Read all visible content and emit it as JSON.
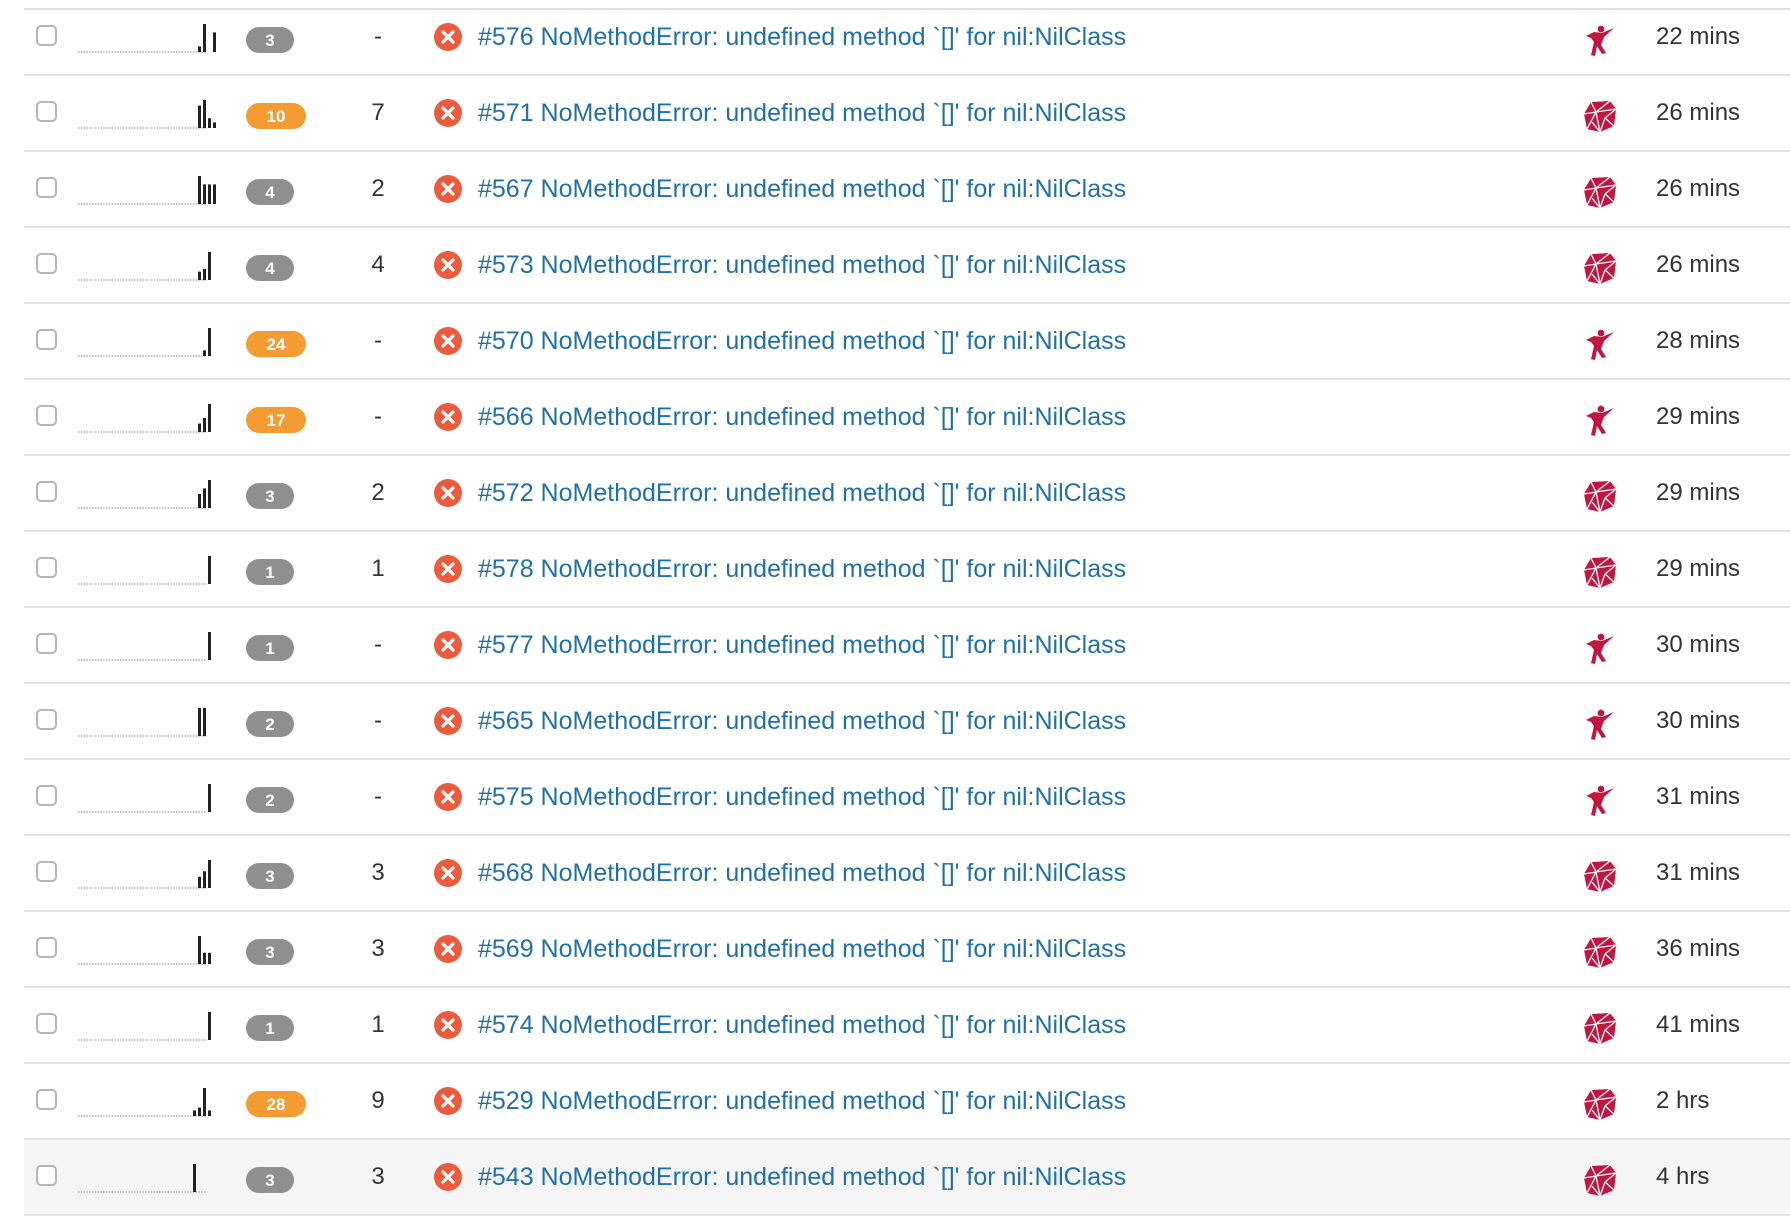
{
  "colors": {
    "link": "#1f6fb0",
    "badge_gray": "#8f8f8f",
    "badge_orange": "#f49b31",
    "error_icon": "#ee5a3c",
    "platform_icon": "#c4153f"
  },
  "rows": [
    {
      "id": "#576",
      "title": "#576 NoMethodError: undefined method `[]' for nil:NilClass",
      "badge": "3",
      "badge_color": "gray",
      "count": "-",
      "platform": "ninja-icon",
      "time": "22 mins",
      "spark": [
        0,
        0,
        0,
        0,
        0,
        0,
        0,
        0,
        0,
        0,
        0,
        0,
        0,
        0,
        0,
        0,
        0,
        0,
        0,
        0,
        0,
        0,
        0,
        0.2,
        1,
        0,
        0.7
      ]
    },
    {
      "id": "#571",
      "title": "#571 NoMethodError: undefined method `[]' for nil:NilClass",
      "badge": "10",
      "badge_color": "orange",
      "count": "7",
      "platform": "ruby-icon",
      "time": "26 mins",
      "spark": [
        0,
        0,
        0,
        0,
        0,
        0,
        0,
        0,
        0,
        0,
        0,
        0,
        0,
        0,
        0,
        0,
        0,
        0,
        0,
        0,
        0,
        0,
        0,
        0,
        0.8,
        1,
        0.35,
        0.2
      ]
    },
    {
      "id": "#567",
      "title": "#567 NoMethodError: undefined method `[]' for nil:NilClass",
      "badge": "4",
      "badge_color": "gray",
      "count": "2",
      "platform": "ruby-icon",
      "time": "26 mins",
      "spark": [
        0,
        0,
        0,
        0,
        0,
        0,
        0,
        0,
        0,
        0,
        0,
        0,
        0,
        0,
        0,
        0,
        0,
        0,
        0,
        0,
        0,
        0,
        0,
        1,
        0.7,
        0.7,
        0.7
      ]
    },
    {
      "id": "#573",
      "title": "#573 NoMethodError: undefined method `[]' for nil:NilClass",
      "badge": "4",
      "badge_color": "gray",
      "count": "4",
      "platform": "ruby-icon",
      "time": "26 mins",
      "spark": [
        0,
        0,
        0,
        0,
        0,
        0,
        0,
        0,
        0,
        0,
        0,
        0,
        0,
        0,
        0,
        0,
        0,
        0,
        0,
        0,
        0,
        0,
        0,
        0,
        0.3,
        0.4,
        1,
        0
      ]
    },
    {
      "id": "#570",
      "title": "#570 NoMethodError: undefined method `[]' for nil:NilClass",
      "badge": "24",
      "badge_color": "orange",
      "count": "-",
      "platform": "ninja-icon",
      "time": "28 mins",
      "spark": [
        0,
        0,
        0,
        0,
        0,
        0,
        0,
        0,
        0,
        0,
        0,
        0,
        0,
        0,
        0,
        0,
        0,
        0,
        0,
        0,
        0,
        0,
        0,
        0,
        0,
        0.2,
        1,
        0
      ]
    },
    {
      "id": "#566",
      "title": "#566 NoMethodError: undefined method `[]' for nil:NilClass",
      "badge": "17",
      "badge_color": "orange",
      "count": "-",
      "platform": "ninja-icon",
      "time": "29 mins",
      "spark": [
        0,
        0,
        0,
        0,
        0,
        0,
        0,
        0,
        0,
        0,
        0,
        0,
        0,
        0,
        0,
        0,
        0,
        0,
        0,
        0,
        0,
        0,
        0,
        0,
        0.3,
        0.5,
        1,
        0
      ]
    },
    {
      "id": "#572",
      "title": "#572 NoMethodError: undefined method `[]' for nil:NilClass",
      "badge": "3",
      "badge_color": "gray",
      "count": "2",
      "platform": "ruby-icon",
      "time": "29 mins",
      "spark": [
        0,
        0,
        0,
        0,
        0,
        0,
        0,
        0,
        0,
        0,
        0,
        0,
        0,
        0,
        0,
        0,
        0,
        0,
        0,
        0,
        0,
        0,
        0,
        0,
        0.5,
        0.7,
        1,
        0
      ]
    },
    {
      "id": "#578",
      "title": "#578 NoMethodError: undefined method `[]' for nil:NilClass",
      "badge": "1",
      "badge_color": "gray",
      "count": "1",
      "platform": "ruby-icon",
      "time": "29 mins",
      "spark": [
        0,
        0,
        0,
        0,
        0,
        0,
        0,
        0,
        0,
        0,
        0,
        0,
        0,
        0,
        0,
        0,
        0,
        0,
        0,
        0,
        0,
        0,
        0,
        0,
        0,
        0,
        1,
        0
      ]
    },
    {
      "id": "#577",
      "title": "#577 NoMethodError: undefined method `[]' for nil:NilClass",
      "badge": "1",
      "badge_color": "gray",
      "count": "-",
      "platform": "ninja-icon",
      "time": "30 mins",
      "spark": [
        0,
        0,
        0,
        0,
        0,
        0,
        0,
        0,
        0,
        0,
        0,
        0,
        0,
        0,
        0,
        0,
        0,
        0,
        0,
        0,
        0,
        0,
        0,
        0,
        0,
        0,
        1,
        0
      ]
    },
    {
      "id": "#565",
      "title": "#565 NoMethodError: undefined method `[]' for nil:NilClass",
      "badge": "2",
      "badge_color": "gray",
      "count": "-",
      "platform": "ninja-icon",
      "time": "30 mins",
      "spark": [
        0,
        0,
        0,
        0,
        0,
        0,
        0,
        0,
        0,
        0,
        0,
        0,
        0,
        0,
        0,
        0,
        0,
        0,
        0,
        0,
        0,
        0,
        0,
        0,
        1,
        1,
        0,
        0
      ]
    },
    {
      "id": "#575",
      "title": "#575 NoMethodError: undefined method `[]' for nil:NilClass",
      "badge": "2",
      "badge_color": "gray",
      "count": "-",
      "platform": "ninja-icon",
      "time": "31 mins",
      "spark": [
        0,
        0,
        0,
        0,
        0,
        0,
        0,
        0,
        0,
        0,
        0,
        0,
        0,
        0,
        0,
        0,
        0,
        0,
        0,
        0,
        0,
        0,
        0,
        0,
        0,
        0,
        1,
        0
      ]
    },
    {
      "id": "#568",
      "title": "#568 NoMethodError: undefined method `[]' for nil:NilClass",
      "badge": "3",
      "badge_color": "gray",
      "count": "3",
      "platform": "ruby-icon",
      "time": "31 mins",
      "spark": [
        0,
        0,
        0,
        0,
        0,
        0,
        0,
        0,
        0,
        0,
        0,
        0,
        0,
        0,
        0,
        0,
        0,
        0,
        0,
        0,
        0,
        0,
        0,
        0,
        0.4,
        0.6,
        1,
        0
      ]
    },
    {
      "id": "#569",
      "title": "#569 NoMethodError: undefined method `[]' for nil:NilClass",
      "badge": "3",
      "badge_color": "gray",
      "count": "3",
      "platform": "ruby-icon",
      "time": "36 mins",
      "spark": [
        0,
        0,
        0,
        0,
        0,
        0,
        0,
        0,
        0,
        0,
        0,
        0,
        0,
        0,
        0,
        0,
        0,
        0,
        0,
        0,
        0,
        0,
        0,
        0,
        1,
        0.4,
        0.4,
        0
      ]
    },
    {
      "id": "#574",
      "title": "#574 NoMethodError: undefined method `[]' for nil:NilClass",
      "badge": "1",
      "badge_color": "gray",
      "count": "1",
      "platform": "ruby-icon",
      "time": "41 mins",
      "spark": [
        0,
        0,
        0,
        0,
        0,
        0,
        0,
        0,
        0,
        0,
        0,
        0,
        0,
        0,
        0,
        0,
        0,
        0,
        0,
        0,
        0,
        0,
        0,
        0,
        0,
        0,
        1,
        0
      ]
    },
    {
      "id": "#529",
      "title": "#529 NoMethodError: undefined method `[]' for nil:NilClass",
      "badge": "28",
      "badge_color": "orange",
      "count": "9",
      "platform": "ruby-icon",
      "time": "2 hrs",
      "spark": [
        0,
        0,
        0,
        0,
        0,
        0,
        0,
        0,
        0,
        0,
        0,
        0,
        0,
        0,
        0,
        0,
        0,
        0,
        0,
        0,
        0,
        0,
        0,
        0.2,
        0.3,
        1,
        0.2,
        0
      ]
    },
    {
      "id": "#543",
      "title": "#543 NoMethodError: undefined method `[]' for nil:NilClass",
      "badge": "3",
      "badge_color": "gray",
      "count": "3",
      "platform": "ruby-icon",
      "time": "4 hrs",
      "spark": [
        0,
        0,
        0,
        0,
        0,
        0,
        0,
        0,
        0,
        0,
        0,
        0,
        0,
        0,
        0,
        0,
        0,
        0,
        0,
        0,
        0,
        0,
        0,
        1,
        0,
        0,
        0,
        0
      ]
    }
  ]
}
